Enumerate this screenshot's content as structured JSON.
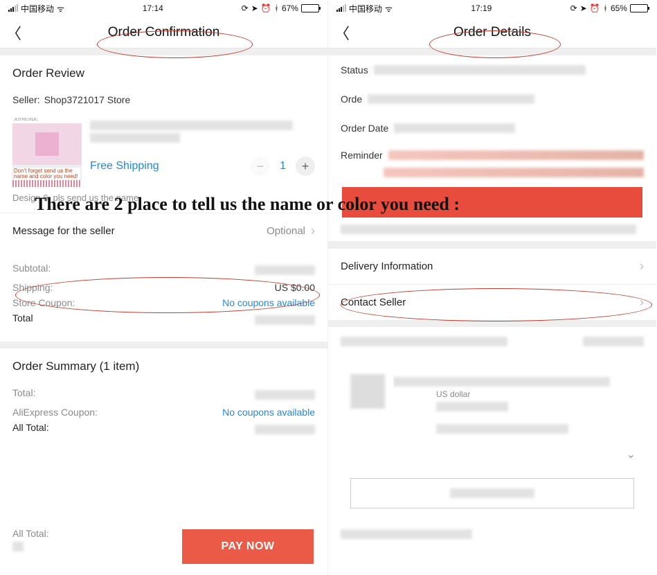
{
  "overlay_text": "There are 2 place to tell us the name or color you need :",
  "left": {
    "status": {
      "carrier": "中国移动",
      "time": "17:14",
      "battery_pct": "67%"
    },
    "header_title": "Order Confirmation",
    "order_review_title": "Order Review",
    "seller_label": "Seller:",
    "seller_name": "Shop3721017 Store",
    "thumb_top": "JOYRESIDE",
    "thumb_note": "Don't forget send us the name and color you need!",
    "free_shipping": "Free Shipping",
    "quantity": "1",
    "variant_note": "Design 6, pls send us the name",
    "msg_seller_label": "Message for the seller",
    "msg_seller_hint": "Optional",
    "subtotal_label": "Subtotal:",
    "shipping_label": "Shipping:",
    "shipping_value": "US $0.00",
    "store_coupon_label": "Store Coupon:",
    "store_coupon_value": "No coupons available",
    "total_label": "Total",
    "summary_title": "Order Summary (1 item)",
    "summary_total_label": "Total:",
    "ali_coupon_label": "AliExpress Coupon:",
    "ali_coupon_value": "No coupons available",
    "all_total_label": "All Total:",
    "footer_all_total": "All Total:",
    "pay_now": "PAY NOW"
  },
  "right": {
    "status": {
      "carrier": "中国移动",
      "time": "17:19",
      "battery_pct": "65%"
    },
    "header_title": "Order Details",
    "status_label": "Status",
    "order_label": "Orde",
    "order_date_label": "Order Date",
    "reminder_label": "Reminder",
    "delivery_info": "Delivery Information",
    "contact_seller": "Contact Seller",
    "currency_note": "US dollar"
  }
}
